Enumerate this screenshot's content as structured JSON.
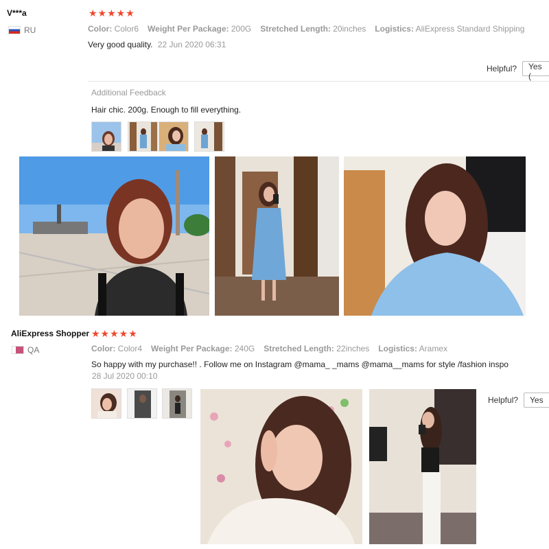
{
  "reviews": [
    {
      "name": "V***a",
      "country": "RU",
      "stars": "★★★★★",
      "props": [
        {
          "label": "Color:",
          "value": "Color6"
        },
        {
          "label": "Weight Per Package:",
          "value": "200G"
        },
        {
          "label": "Stretched Length:",
          "value": "20inches"
        },
        {
          "label": "Logistics:",
          "value": "AliExpress Standard Shipping"
        }
      ],
      "text": "Very good quality.",
      "date": "22 Jun 2020 06:31",
      "helpful_label": "Helpful?",
      "yes_label": "Yes (",
      "additional_label": "Additional Feedback",
      "additional_text": "Hair chic. 200g. Enough to fill everything."
    },
    {
      "name": "AliExpress Shopper",
      "country": "QA",
      "stars": "★★★★★",
      "props": [
        {
          "label": "Color:",
          "value": "Color4"
        },
        {
          "label": "Weight Per Package:",
          "value": "240G"
        },
        {
          "label": "Stretched Length:",
          "value": "22inches"
        },
        {
          "label": "Logistics:",
          "value": "Aramex"
        }
      ],
      "text": "So happy with my purchase!! . Follow me on Instagram @mama_ _mams @mama__mams for style /fashion inspo",
      "date": "28 Jul 2020 00:10",
      "helpful_label": "Helpful?",
      "yes_label": "Yes"
    }
  ],
  "colors": {
    "star": "#f0462c",
    "label": "#999999"
  }
}
